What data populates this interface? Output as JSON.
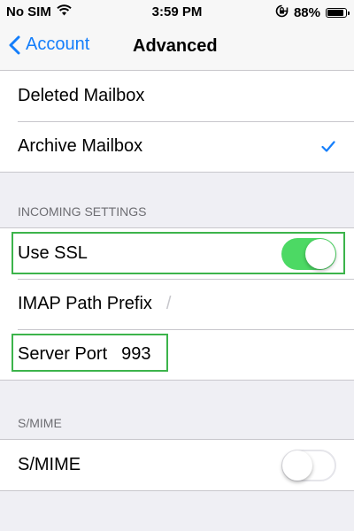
{
  "status_bar": {
    "carrier": "No SIM",
    "time": "3:59 PM",
    "battery": "88%",
    "battery_level": 0.88
  },
  "nav": {
    "back_label": "Account",
    "title": "Advanced"
  },
  "mailboxes": {
    "deleted_label": "Deleted Mailbox",
    "archive_label": "Archive Mailbox"
  },
  "incoming": {
    "header": "INCOMING SETTINGS",
    "ssl_label": "Use SSL",
    "ssl_on": true,
    "imap_label": "IMAP Path Prefix",
    "imap_value": "/",
    "port_label": "Server Port",
    "port_value": "993"
  },
  "smime": {
    "header": "S/MIME",
    "label": "S/MIME",
    "on": false
  },
  "colors": {
    "accent": "#147efb",
    "toggle_on": "#4cd964",
    "highlight": "#3cb44b"
  }
}
